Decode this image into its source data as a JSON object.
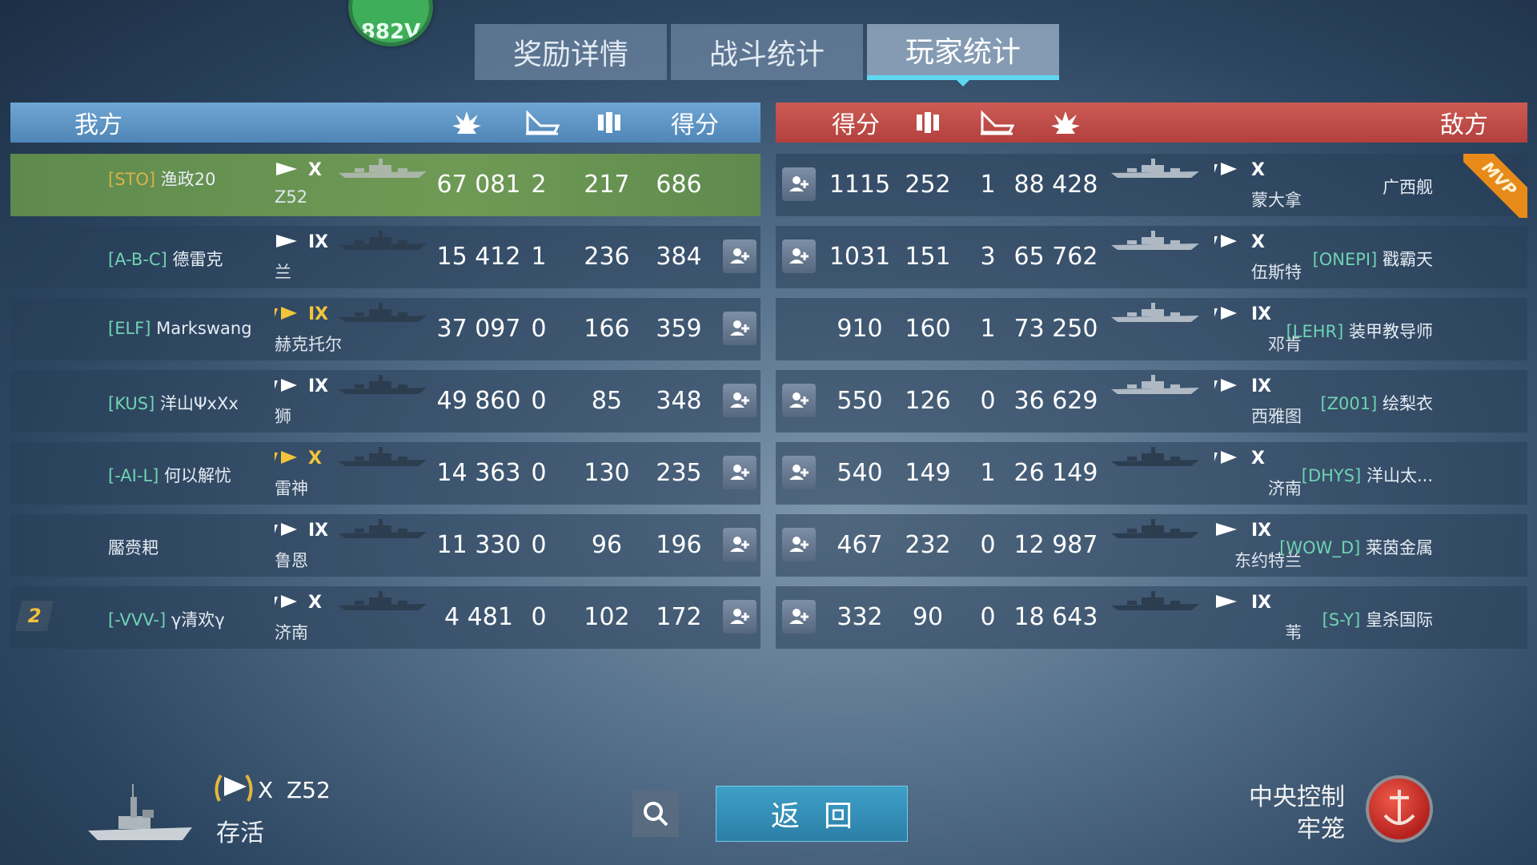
{
  "top_badge": "882V",
  "tabs": [
    {
      "label": "奖励详情"
    },
    {
      "label": "战斗统计"
    },
    {
      "label": "玩家统计"
    }
  ],
  "ally_header": {
    "side_label": "我方",
    "score_label": "得分"
  },
  "enemy_header": {
    "side_label": "敌方",
    "score_label": "得分"
  },
  "ally_rows": [
    {
      "clan": "[STO]",
      "name": "渔政20",
      "tier": "X",
      "ship": "Z52",
      "damage": "67 081",
      "kills": "2",
      "xp": "217",
      "score": "686"
    },
    {
      "clan": "[A-B-C]",
      "name": "德雷克",
      "tier": "IX",
      "ship": "兰",
      "damage": "15 412",
      "kills": "1",
      "xp": "236",
      "score": "384"
    },
    {
      "clan": "[ELF]",
      "name": "Markswang",
      "tier": "IX",
      "ship": "赫克托尔",
      "damage": "37 097",
      "kills": "0",
      "xp": "166",
      "score": "359"
    },
    {
      "clan": "[KUS]",
      "name": "洋山ΨxXx",
      "tier": "IX",
      "ship": "狮",
      "damage": "49 860",
      "kills": "0",
      "xp": "85",
      "score": "348"
    },
    {
      "clan": "[-AI-L]",
      "name": "何以解忧",
      "tier": "X",
      "ship": "雷神",
      "damage": "14 363",
      "kills": "0",
      "xp": "130",
      "score": "235"
    },
    {
      "clan": "",
      "name": "靨赍耙",
      "tier": "IX",
      "ship": "鲁恩",
      "damage": "11 330",
      "kills": "0",
      "xp": "96",
      "score": "196"
    },
    {
      "clan": "[-VVV-]",
      "name": "γ清欢γ",
      "tier": "X",
      "ship": "济南",
      "damage": "4 481",
      "kills": "0",
      "xp": "102",
      "score": "172",
      "rank": "2"
    }
  ],
  "enemy_rows": [
    {
      "clan": "",
      "name": "广西舰",
      "tier": "X",
      "ship": "蒙大拿",
      "damage": "88 428",
      "kills": "1",
      "xp": "252",
      "score": "1115",
      "mvp": "MVP"
    },
    {
      "clan": "[ONEPI]",
      "name": "戳霸天",
      "tier": "X",
      "ship": "伍斯特",
      "damage": "65 762",
      "kills": "3",
      "xp": "151",
      "score": "1031"
    },
    {
      "clan": "[LEHR]",
      "name": "装甲教导师",
      "tier": "IX",
      "ship": "邓肯",
      "damage": "73 250",
      "kills": "1",
      "xp": "160",
      "score": "910"
    },
    {
      "clan": "[Z001]",
      "name": "绘梨衣",
      "tier": "IX",
      "ship": "西雅图",
      "damage": "36 629",
      "kills": "0",
      "xp": "126",
      "score": "550"
    },
    {
      "clan": "[DHYS]",
      "name": "洋山太...",
      "tier": "X",
      "ship": "济南",
      "damage": "26 149",
      "kills": "1",
      "xp": "149",
      "score": "540"
    },
    {
      "clan": "[WOW_D]",
      "name": "莱茵金属",
      "tier": "IX",
      "ship": "东约特兰",
      "damage": "12 987",
      "kills": "0",
      "xp": "232",
      "score": "467"
    },
    {
      "clan": "[S-Y]",
      "name": "皇杀国际",
      "tier": "IX",
      "ship": "苇",
      "damage": "18 643",
      "kills": "0",
      "xp": "90",
      "score": "332"
    }
  ],
  "bottom": {
    "tier": "X",
    "ship": "Z52",
    "status": "存活",
    "back_label": "返回",
    "mode_line1": "中央控制",
    "mode_line2": "牢笼"
  },
  "colors": {
    "ally": "#5a93c4",
    "enemy": "#be4a45",
    "mvp_row": "#6a9552",
    "clan": "#6fd3b2",
    "tier_gold": "#f2c53a",
    "accent": "#5fd7ef"
  }
}
